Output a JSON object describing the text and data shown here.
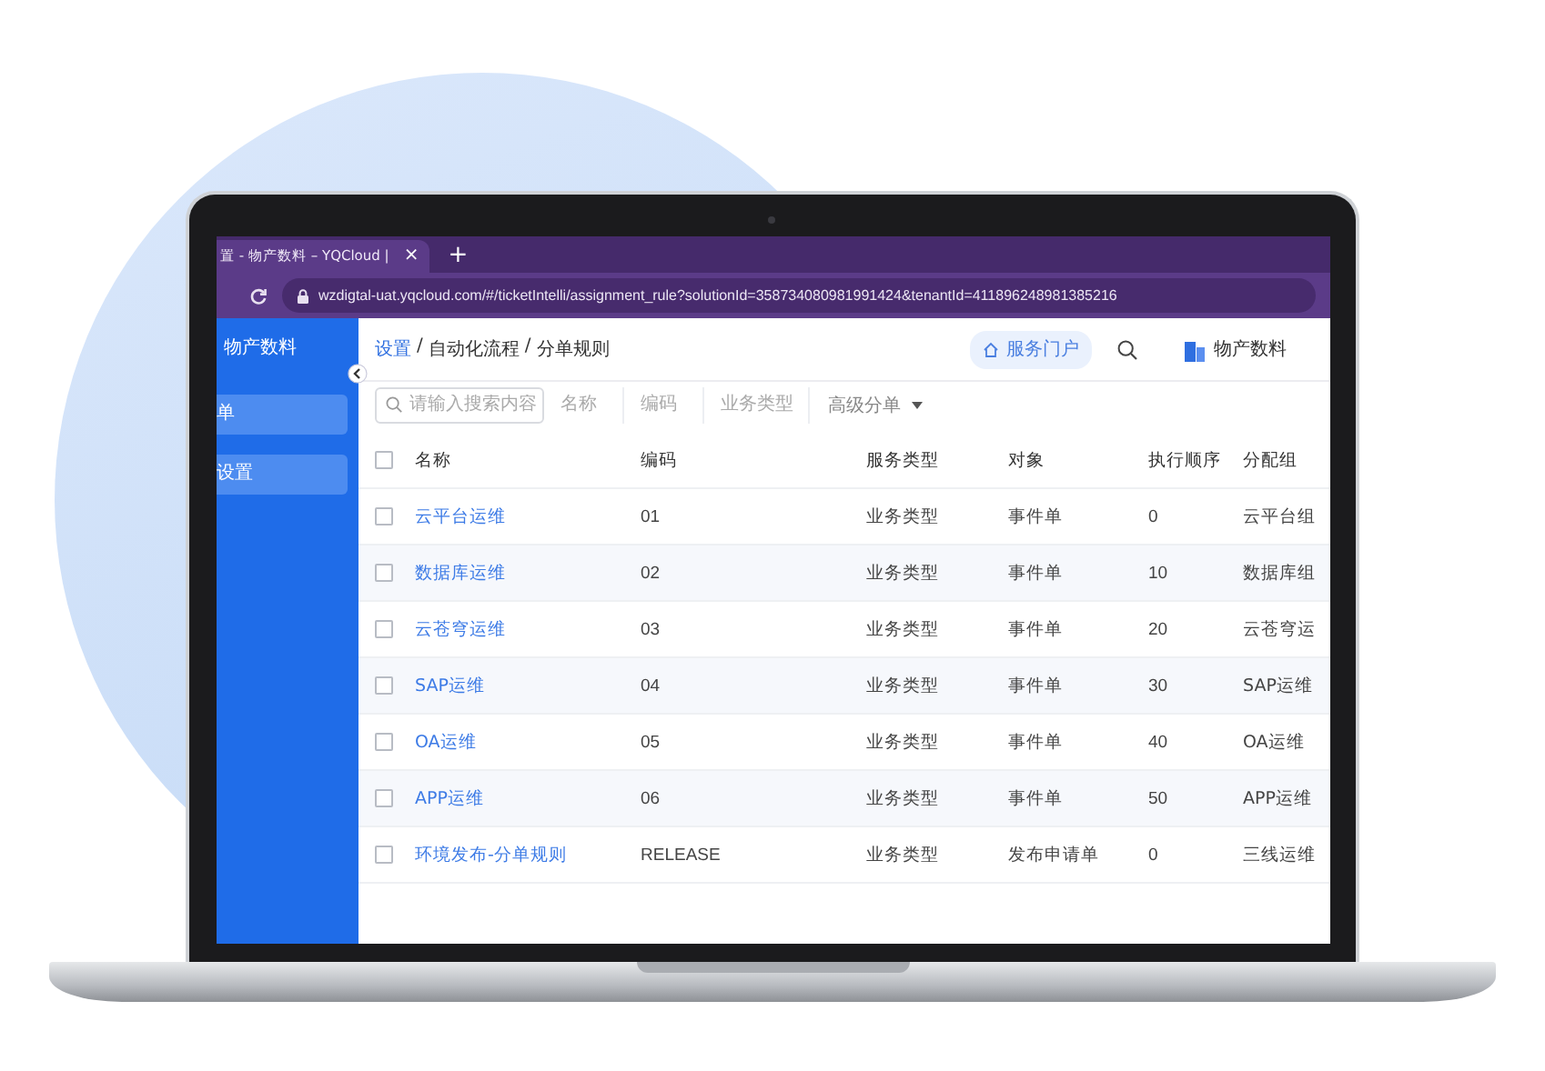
{
  "browser": {
    "tab_title": "置 - 物产数料 – YQCloud |",
    "tab_close": "×",
    "new_tab": "+",
    "url": "wzdigtal-uat.yqcloud.com/#/ticketIntelli/assignment_rule?solutionId=358734080981991424&tenantId=411896248981385216"
  },
  "sidebar": {
    "title": "物产数料",
    "items": [
      {
        "label": "单"
      },
      {
        "label": "设置"
      }
    ]
  },
  "header": {
    "breadcrumb": [
      {
        "label": "设置",
        "kind": "link"
      },
      {
        "label": "/",
        "kind": "separator"
      },
      {
        "label": "自动化流程",
        "kind": "text"
      },
      {
        "label": "/",
        "kind": "separator"
      },
      {
        "label": "分单规则",
        "kind": "text"
      }
    ],
    "portal_button": "服务门户",
    "account": "物产数料"
  },
  "filters": {
    "search_placeholder": "请输入搜索内容",
    "fields": [
      {
        "placeholder": "名称"
      },
      {
        "placeholder": "编码"
      },
      {
        "placeholder": "业务类型"
      }
    ],
    "advanced": "高级分单"
  },
  "table": {
    "header_checked": false,
    "columns": [
      "名称",
      "编码",
      "服务类型",
      "对象",
      "执行顺序",
      "分配组"
    ],
    "rows": [
      {
        "checked": false,
        "cells": [
          "云平台运维",
          "01",
          "业务类型",
          "事件单",
          "0",
          "云平台组"
        ]
      },
      {
        "checked": false,
        "cells": [
          "数据库运维",
          "02",
          "业务类型",
          "事件单",
          "10",
          "数据库组"
        ]
      },
      {
        "checked": false,
        "cells": [
          "云苍穹运维",
          "03",
          "业务类型",
          "事件单",
          "20",
          "云苍穹运"
        ]
      },
      {
        "checked": false,
        "cells": [
          "SAP运维",
          "04",
          "业务类型",
          "事件单",
          "30",
          "SAP运维"
        ]
      },
      {
        "checked": false,
        "cells": [
          "OA运维",
          "05",
          "业务类型",
          "事件单",
          "40",
          "OA运维"
        ]
      },
      {
        "checked": false,
        "cells": [
          "APP运维",
          "06",
          "业务类型",
          "事件单",
          "50",
          "APP运维"
        ]
      },
      {
        "checked": false,
        "cells": [
          "环境发布-分单规则",
          "RELEASE",
          "业务类型",
          "发布申请单",
          "0",
          "三线运维"
        ]
      }
    ]
  }
}
